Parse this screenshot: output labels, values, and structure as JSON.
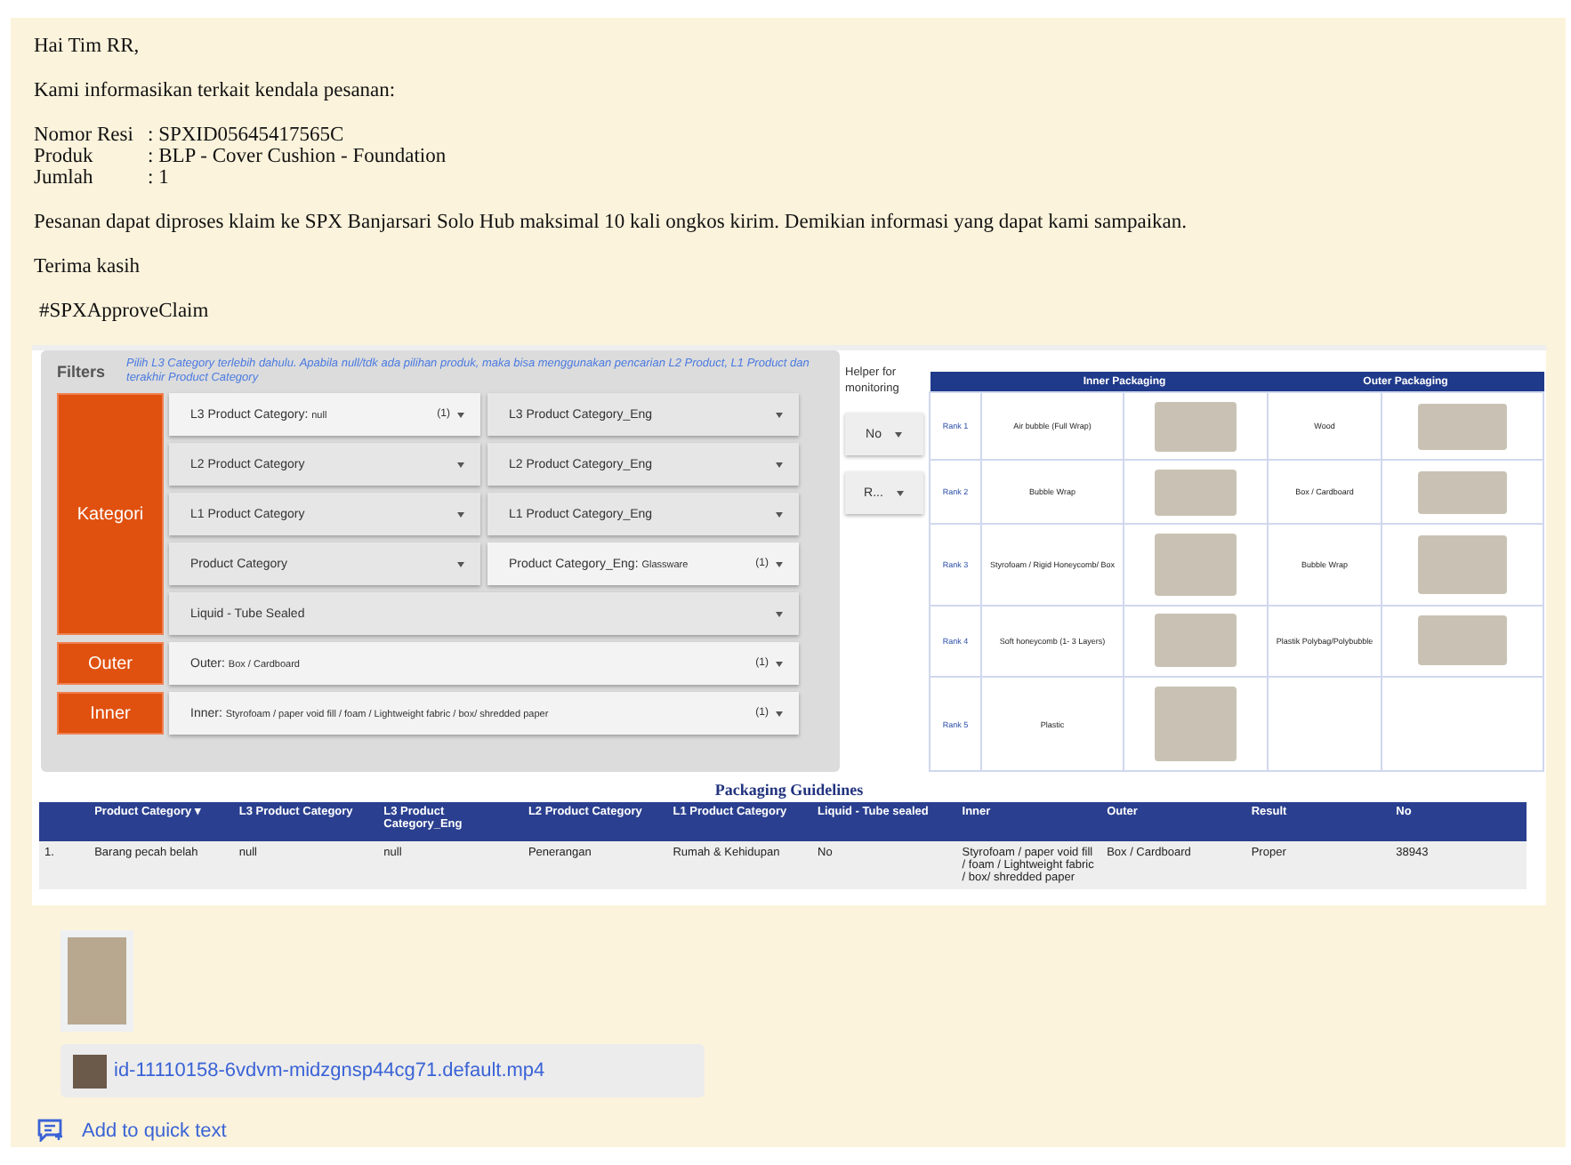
{
  "message": {
    "greeting": "Hai Tim RR,",
    "intro": "Kami informasikan terkait kendala pesanan:",
    "fields": [
      {
        "label": "Nomor Resi",
        "value": ": SPXID05645417565C"
      },
      {
        "label": "Produk",
        "value": ": BLP - Cover Cushion - Foundation"
      },
      {
        "label": "Jumlah",
        "value": ": 1"
      }
    ],
    "body": "Pesanan dapat diproses klaim ke SPX Banjarsari Solo Hub maksimal 10 kali ongkos kirim. Demikian informasi yang dapat kami sampaikan.",
    "closing": "Terima kasih",
    "hashtag": "#SPXApproveClaim"
  },
  "dashboard": {
    "filters_title": "Filters",
    "filters_note": "Pilih L3 Category terlebih dahulu. Apabila null/tdk ada pilihan produk, maka bisa menggunakan pencarian L2 Product, L1 Product dan terakhir Product Category",
    "groups": [
      {
        "label": "Kategori",
        "filters": [
          {
            "label": "L3 Product Category:",
            "value": "null",
            "count": "(1)"
          },
          {
            "label": "L3 Product Category_Eng"
          },
          {
            "label": "L2 Product Category"
          },
          {
            "label": "L2 Product Category_Eng"
          },
          {
            "label": "L1 Product Category"
          },
          {
            "label": "L1 Product Category_Eng"
          },
          {
            "label": "Product Category"
          },
          {
            "label": "Product Category_Eng:",
            "value": "Glassware",
            "count": "(1)"
          },
          {
            "label": "Liquid - Tube Sealed"
          }
        ]
      },
      {
        "label": "Outer",
        "filters": [
          {
            "label": "Outer:",
            "value": "Box / Cardboard",
            "count": "(1)"
          }
        ]
      },
      {
        "label": "Inner",
        "filters": [
          {
            "label": "Inner:",
            "value": "Styrofoam / paper void fill / foam / Lightweight fabric / box/ shredded paper",
            "count": "(1)"
          }
        ]
      }
    ],
    "helper": {
      "title": "Helper for monitoring",
      "dropdowns": [
        "No",
        "R..."
      ]
    },
    "packaging": {
      "headers": [
        "Inner Packaging",
        "Outer Packaging"
      ],
      "rows": [
        {
          "rank": "Rank 1",
          "inner": "Air bubble (Full Wrap)",
          "outer": "Wood"
        },
        {
          "rank": "Rank 2",
          "inner": "Bubble Wrap",
          "outer": "Box / Cardboard"
        },
        {
          "rank": "Rank 3",
          "inner": "Styrofoam / Rigid Honeycomb/ Box",
          "outer": "Bubble Wrap"
        },
        {
          "rank": "Rank 4",
          "inner": "Soft honeycomb (1- 3 Layers)",
          "outer": "Plastik Polybag/Polybubble"
        },
        {
          "rank": "Rank 5",
          "inner": "Plastic"
        }
      ]
    },
    "guidelines": {
      "title": "Packaging Guidelines",
      "columns": [
        "Product Category ▾",
        "L3 Product Category",
        "L3 Product Category_Eng",
        "L2 Product Category",
        "L1 Product Category",
        "Liquid - Tube sealed",
        "Inner",
        "Outer",
        "Result",
        "No"
      ],
      "rows": [
        {
          "index": "1.",
          "cells": [
            "Barang pecah belah",
            "null",
            "null",
            "Penerangan",
            "Rumah & Kehidupan",
            "No",
            "Styrofoam / paper void fill / foam / Lightweight fabric / box/ shredded paper",
            "Box / Cardboard",
            "Proper",
            "38943"
          ]
        }
      ]
    }
  },
  "attachments": {
    "video_name": "id-11110158-6vdvm-midzgnsp44cg71.default.mp4",
    "quick_text": "Add to quick text"
  }
}
